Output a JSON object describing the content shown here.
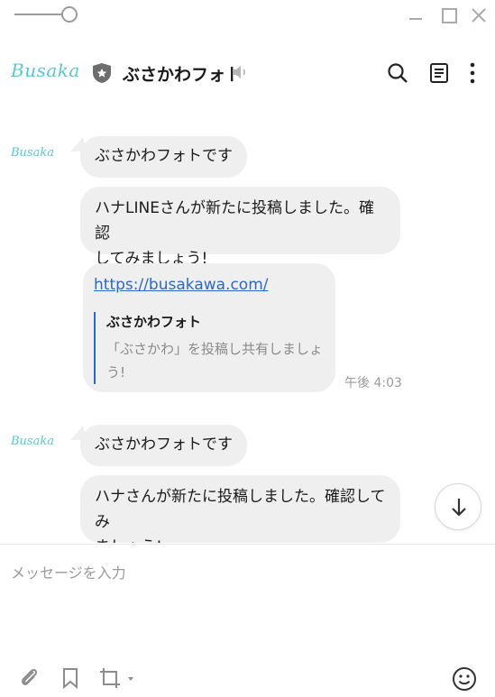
{
  "header": {
    "logo_text": "Busaka",
    "room_name": "ぶさかわフォト"
  },
  "messages": [
    {
      "sender_logo": "Busaka",
      "text": "ぶさかわフォトです"
    },
    {
      "text_line1": "ハナLINEさんが新たに投稿しました。確認",
      "text_line2": "してみましょう!"
    },
    {
      "link": "https://busakawa.com/",
      "preview_title": "ぶさかわフォト",
      "preview_desc_line1": "「ぶさかわ」を投稿し共有しましょ",
      "preview_desc_line2": "う!",
      "time": "午後 4:03"
    },
    {
      "sender_logo": "Busaka",
      "text": "ぶさかわフォトです"
    },
    {
      "text_line1": "ハナさんが新たに投稿しました。確認してみ",
      "text_line2": "ましょう!"
    }
  ],
  "composer": {
    "placeholder": "メッセージを入力"
  },
  "colors": {
    "accent_logo": "#5bc6d3",
    "bubble_bg": "#efefef",
    "link": "#2d67c8"
  },
  "icons": [
    "opacity-slider",
    "minimize-icon",
    "maximize-icon",
    "close-icon",
    "shield-icon",
    "speaker-icon",
    "search-icon",
    "notes-icon",
    "more-icon",
    "arrow-down-icon",
    "paperclip-icon",
    "bookmark-icon",
    "crop-icon",
    "emoji-icon"
  ]
}
